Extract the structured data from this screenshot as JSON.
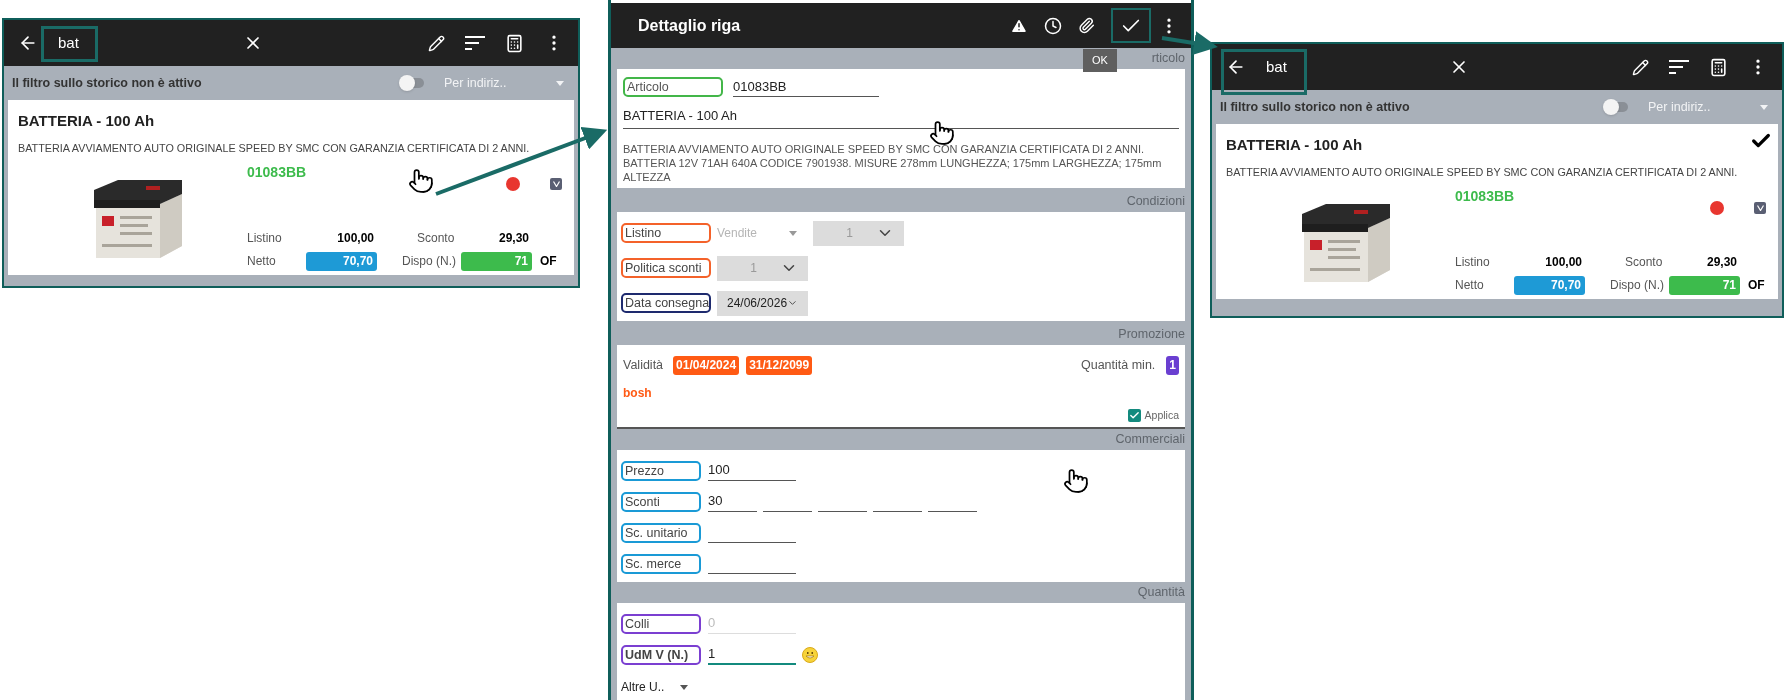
{
  "screens": [
    {
      "kind": "list",
      "search": "bat",
      "selected": false,
      "filter_label": "Il filtro sullo storico non è attivo",
      "filter_on": false,
      "address_filter": "Per indiriz..",
      "item": {
        "title": "BATTERIA - 100 Ah",
        "description": "BATTERIA AVVIAMENTO AUTO ORIGINALE SPEED BY SMC CON GARANZIA CERTIFICATA DI 2 ANNI.",
        "code": "01083BB",
        "listino_label": "Listino",
        "listino": "100,00",
        "sconto_label": "Sconto",
        "sconto": "29,30",
        "netto_label": "Netto",
        "netto": "70,70",
        "dispo_label": "Dispo (N.)",
        "dispo": "71",
        "dispo_note": "OF"
      }
    },
    {
      "kind": "detail",
      "title": "Dettaglio riga",
      "tooltip": "OK",
      "sections": [
        {
          "kind": "article",
          "title": "rticolo",
          "field": {
            "label": "Articolo",
            "color": "#43b649",
            "value": "01083BB"
          },
          "name": "BATTERIA - 100 Ah",
          "description": "BATTERIA AVVIAMENTO AUTO ORIGINALE SPEED BY SMC CON GARANZIA CERTIFICATA DI 2 ANNI. BATTERIA 12V 71AH 640A CODICE 7901938. MISURE 278mm LUNGHEZZA; 175mm LARGHEZZA; 175mm ALTEZZA"
        },
        {
          "kind": "conditions",
          "title": "Condizioni",
          "rows": [
            {
              "label": "Listino",
              "color": "#f4622a",
              "dropdown": "Vendite",
              "combo": "1",
              "combo_disabled": true
            },
            {
              "label": "Politica sconti",
              "color": "#f4622a",
              "combo": "1",
              "combo_disabled": true
            },
            {
              "label": "Data consegna",
              "color": "#1e2a6e",
              "combo": "24/06/2026",
              "combo_disabled": false
            }
          ]
        },
        {
          "kind": "promotion",
          "title": "Promozione",
          "validity_label": "Validità",
          "dates": [
            "01/04/2024",
            "31/12/2099"
          ],
          "min_qty_label": "Quantità min.",
          "min_qty": "1",
          "promo_name": "bosh",
          "apply_label": "Applica",
          "apply_checked": true
        },
        {
          "kind": "fields",
          "title": "Commerciali",
          "rows": [
            {
              "kind": "plain",
              "label": "Prezzo",
              "color": "#1a9ad6",
              "disabled": false,
              "focused": false,
              "slots": [
                {
                  "kind": "value",
                  "value": "100"
                }
              ]
            },
            {
              "kind": "plain",
              "label": "Sconti",
              "color": "#1a9ad6",
              "disabled": false,
              "focused": false,
              "slots": [
                {
                  "kind": "value",
                  "value": "30"
                },
                {
                  "kind": "blank"
                },
                {
                  "kind": "blank"
                },
                {
                  "kind": "blank"
                },
                {
                  "kind": "blank"
                }
              ]
            },
            {
              "kind": "plain",
              "label": "Sc. unitario",
              "color": "#1a9ad6",
              "disabled": false,
              "focused": false,
              "slots": [
                {
                  "kind": "blank"
                }
              ]
            },
            {
              "kind": "plain",
              "label": "Sc. merce",
              "color": "#1a9ad6",
              "disabled": false,
              "focused": false,
              "slots": [
                {
                  "kind": "blank"
                }
              ]
            }
          ]
        },
        {
          "kind": "fields",
          "title": "Quantità",
          "rows": [
            {
              "kind": "plain",
              "label": "Colli",
              "color": "#7b3fd1",
              "disabled": true,
              "focused": false,
              "slots": [
                {
                  "kind": "value",
                  "value": "0"
                }
              ]
            },
            {
              "kind": "unit",
              "label": "UdM V (N.)",
              "color": "#7b3fd1",
              "disabled": false,
              "focused": true,
              "slots": [
                {
                  "kind": "value",
                  "value": "1"
                }
              ]
            }
          ],
          "other_units": "Altre U.."
        }
      ]
    },
    {
      "kind": "list",
      "search": "bat",
      "selected": true,
      "filter_label": "Il filtro sullo storico non è attivo",
      "filter_on": false,
      "address_filter": "Per indiriz..",
      "item": {
        "title": "BATTERIA - 100 Ah",
        "description": "BATTERIA AVVIAMENTO AUTO ORIGINALE SPEED BY SMC CON GARANZIA CERTIFICATA DI 2 ANNI.",
        "code": "01083BB",
        "listino_label": "Listino",
        "listino": "100,00",
        "sconto_label": "Sconto",
        "sconto": "29,30",
        "netto_label": "Netto",
        "netto": "70,70",
        "dispo_label": "Dispo (N.)",
        "dispo": "71",
        "dispo_note": "OF"
      }
    }
  ]
}
